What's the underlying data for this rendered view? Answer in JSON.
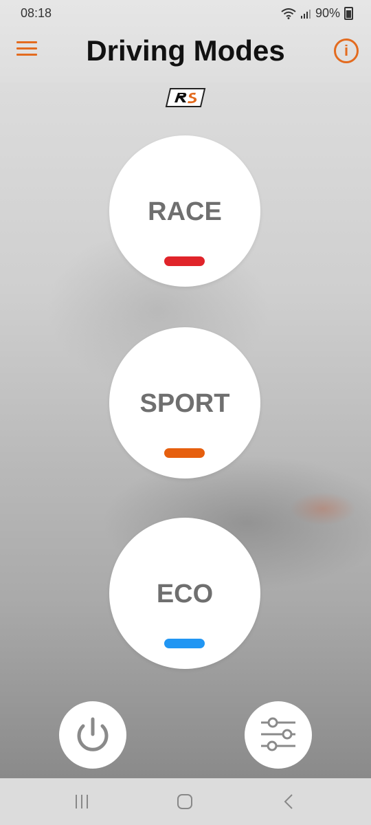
{
  "status_bar": {
    "time": "08:18",
    "battery": "90%"
  },
  "header": {
    "title": "Driving Modes",
    "menu_icon": "hamburger-menu-icon",
    "info_icon": "info-icon",
    "accent_color": "#e36b1f"
  },
  "modes": [
    {
      "label": "RACE",
      "color": "#e0242a"
    },
    {
      "label": "SPORT",
      "color": "#e65f0e"
    },
    {
      "label": "ECO",
      "color": "#2196f3"
    }
  ],
  "bottom_controls": {
    "power_icon": "power-icon",
    "settings_icon": "sliders-icon"
  },
  "system_nav": {
    "recents_icon": "recents-icon",
    "home_icon": "home-icon",
    "back_icon": "back-icon"
  }
}
